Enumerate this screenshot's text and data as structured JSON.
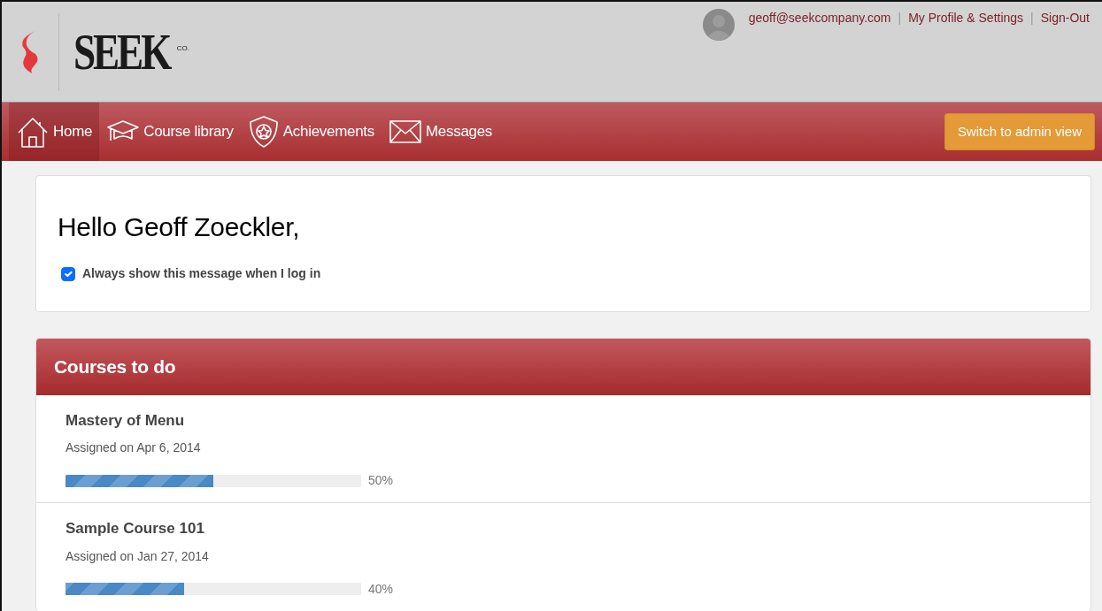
{
  "logo": {
    "wordmark": "SEEK",
    "suffix": "CO."
  },
  "user_menu": {
    "email": "geoff@seekcompany.com",
    "links": [
      "My Profile & Settings",
      "Sign-Out"
    ],
    "separators": [
      "|",
      "|"
    ]
  },
  "nav": {
    "items": [
      {
        "label": "Home",
        "selected": true
      },
      {
        "label": "Course library",
        "selected": false
      },
      {
        "label": "Achievements",
        "selected": false
      },
      {
        "label": "Messages",
        "selected": false
      }
    ],
    "admin_button": "Switch to admin view"
  },
  "welcome": {
    "heading": "Hello Geoff Zoeckler,",
    "checkbox": {
      "label": "Always show this message when I log in",
      "checked": true
    }
  },
  "courses": {
    "title": "Courses to do",
    "items": [
      {
        "name": "Mastery of Menu",
        "assigned": "Assigned on Apr 6, 2014",
        "level": 0.5,
        "reading": "50%"
      },
      {
        "name": "Sample Course 101",
        "assigned": "Assigned on Jan 27, 2014",
        "level": 0.4,
        "reading": "40%"
      }
    ]
  }
}
